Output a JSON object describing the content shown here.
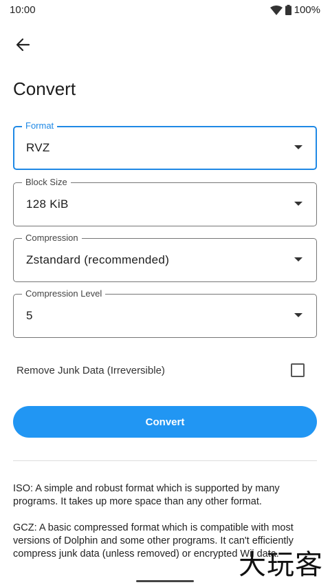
{
  "status_bar": {
    "time": "10:00",
    "battery": "100%"
  },
  "header": {
    "title": "Convert"
  },
  "fields": {
    "format": {
      "label": "Format",
      "value": "RVZ"
    },
    "block_size": {
      "label": "Block Size",
      "value": "128 KiB"
    },
    "compression": {
      "label": "Compression",
      "value": "Zstandard (recommended)"
    },
    "compression_level": {
      "label": "Compression Level",
      "value": "5"
    }
  },
  "junk_data": {
    "label": "Remove Junk Data (Irreversible)",
    "checked": false
  },
  "convert_button": {
    "label": "Convert"
  },
  "descriptions": {
    "iso": "ISO: A simple and robust format which is supported by many programs. It takes up more space than any other format.",
    "gcz": "GCZ: A basic compressed format which is compatible with most versions of Dolphin and some other programs. It can't efficiently compress junk data (unless removed) or encrypted Wii data."
  },
  "watermark": "大玩客"
}
